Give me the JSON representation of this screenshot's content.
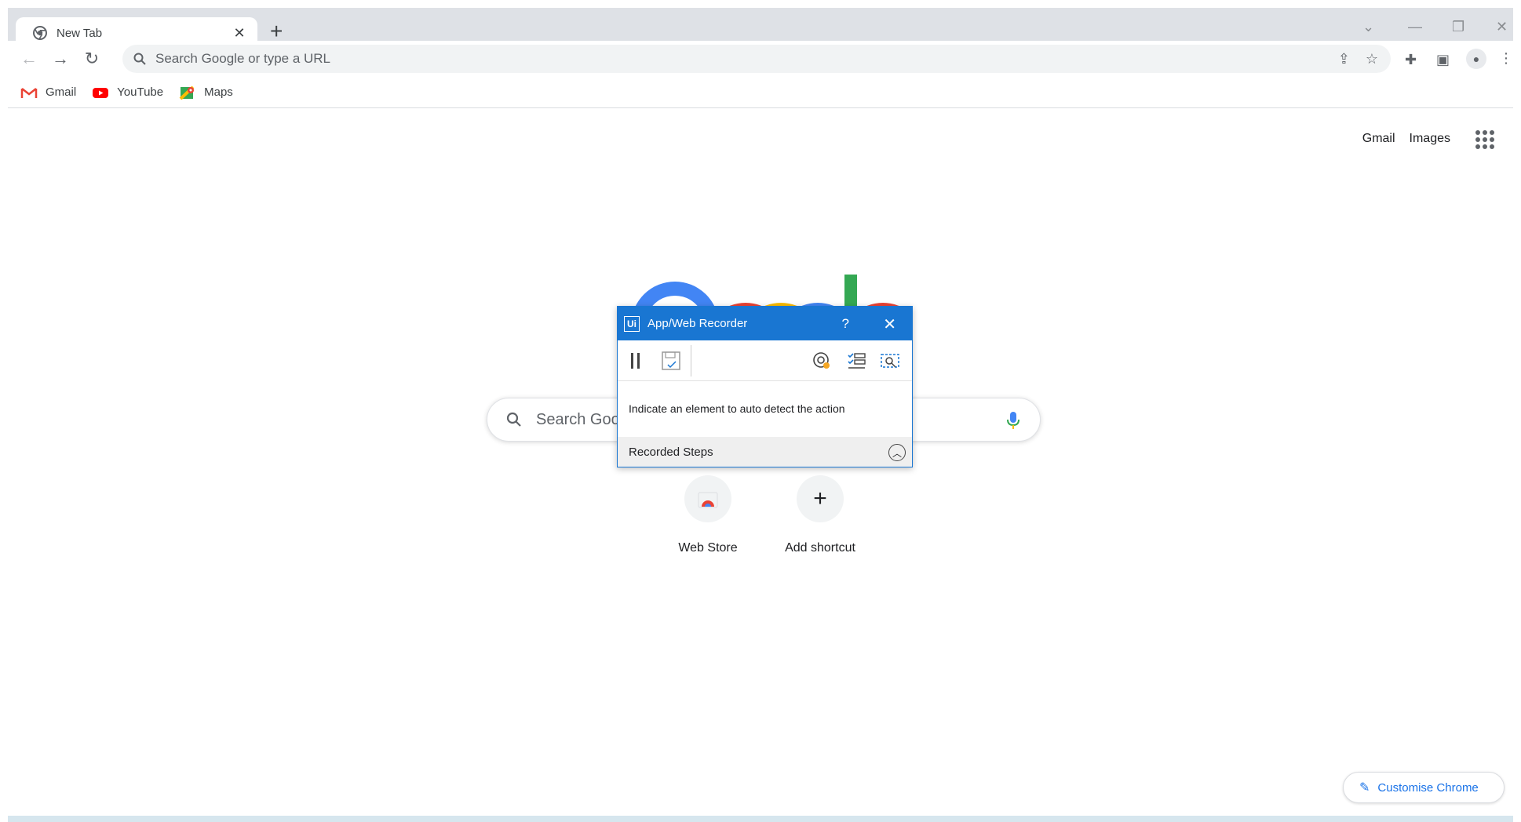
{
  "browser": {
    "tab_title": "New Tab",
    "omnibox_placeholder": "Search Google or type a URL",
    "bookmarks": [
      {
        "label": "Gmail",
        "icon": "gmail-icon"
      },
      {
        "label": "YouTube",
        "icon": "youtube-icon"
      },
      {
        "label": "Maps",
        "icon": "maps-icon"
      }
    ]
  },
  "ntp": {
    "top_links": [
      "Gmail",
      "Images"
    ],
    "search_placeholder": "Search Google",
    "shortcuts": [
      {
        "label": "Web Store",
        "icon": "webstore-icon"
      },
      {
        "label": "Add shortcut",
        "icon": "plus-icon"
      }
    ],
    "customise_label": "Customise Chrome"
  },
  "recorder": {
    "title": "App/Web Recorder",
    "help": "?",
    "message": "Indicate an element to auto detect the action",
    "steps_label": "Recorded Steps"
  },
  "colors": {
    "recorder_blue": "#1976d2",
    "link_blue": "#1a73e8"
  }
}
